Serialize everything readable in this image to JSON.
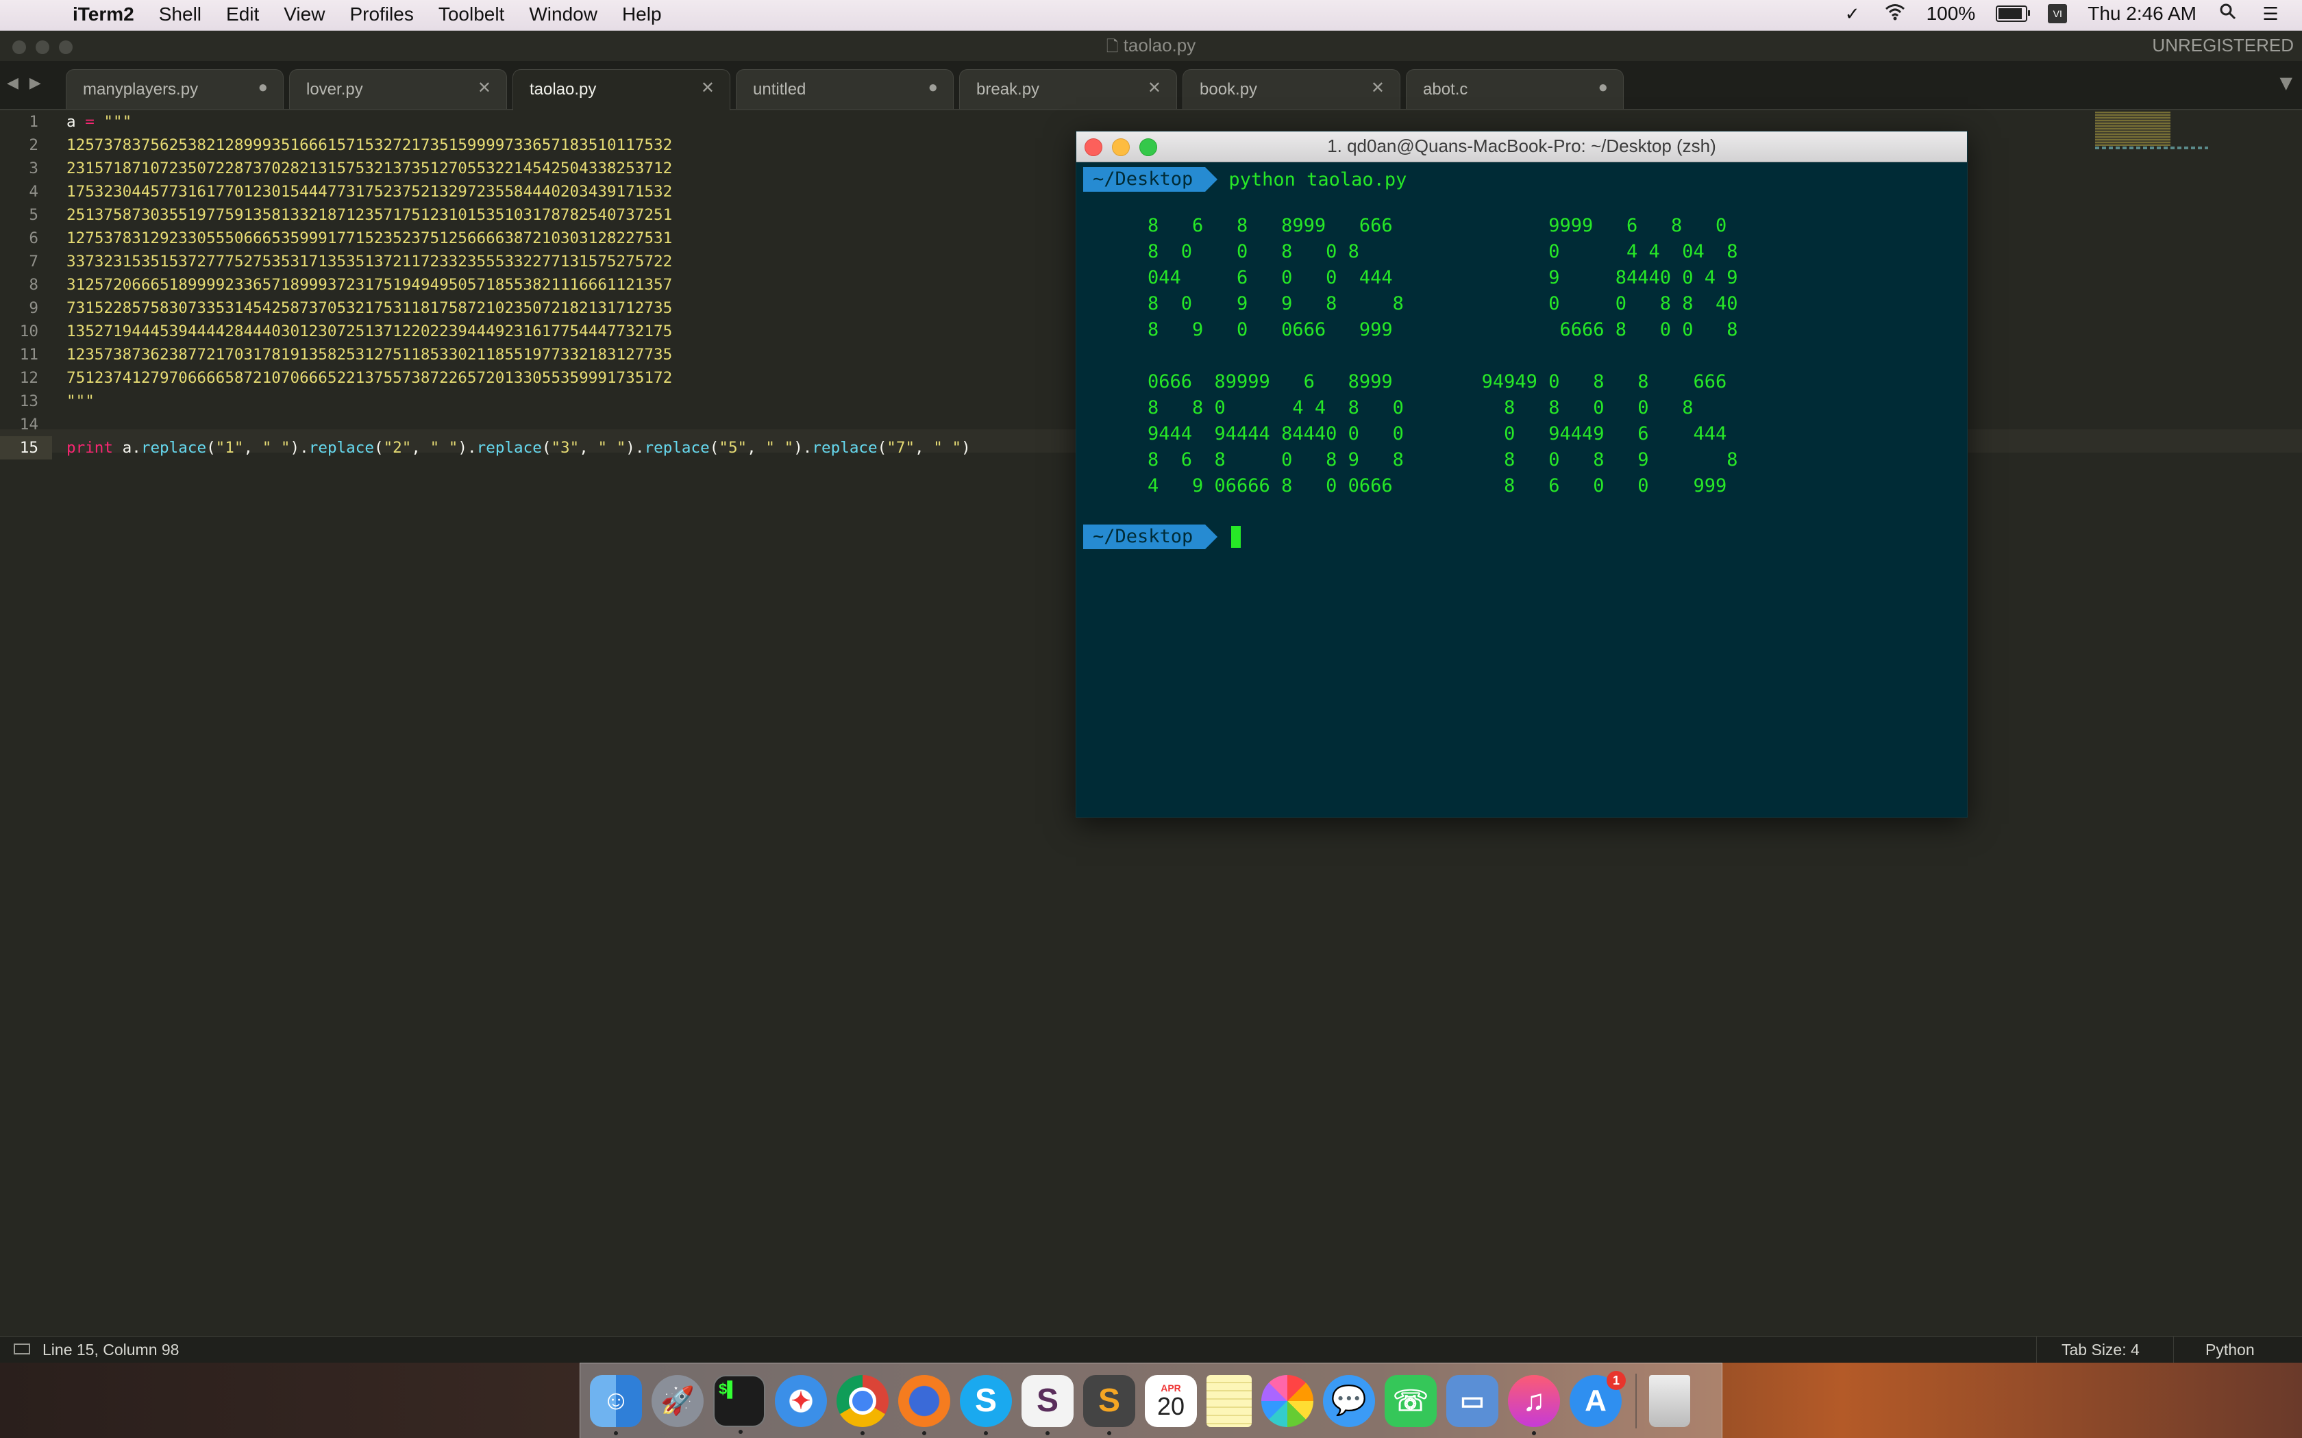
{
  "menubar": {
    "app_name": "iTerm2",
    "menus": [
      "Shell",
      "Edit",
      "View",
      "Profiles",
      "Toolbelt",
      "Window",
      "Help"
    ],
    "battery_percent": "100%",
    "clock": "Thu 2:46 AM"
  },
  "window": {
    "title": "taolao.py",
    "unregistered": "UNREGISTERED"
  },
  "tabs": [
    {
      "label": "manyplayers.py",
      "close": "●",
      "active": false
    },
    {
      "label": "lover.py",
      "close": "✕",
      "active": false
    },
    {
      "label": "taolao.py",
      "close": "✕",
      "active": true
    },
    {
      "label": "untitled",
      "close": "●",
      "active": false
    },
    {
      "label": "break.py",
      "close": "✕",
      "active": false
    },
    {
      "label": "book.py",
      "close": "✕",
      "active": false
    },
    {
      "label": "abot.c",
      "close": "●",
      "active": false
    }
  ],
  "editor": {
    "line_numbers": [
      "1",
      "2",
      "3",
      "4",
      "5",
      "6",
      "7",
      "8",
      "9",
      "10",
      "11",
      "12",
      "13",
      "14",
      "15"
    ],
    "current_line": 15,
    "line1": {
      "var": "a",
      "op": " = ",
      "str": "\"\"\""
    },
    "data_lines": [
      "12573783756253821289993516661571532721735159999733657183510117532",
      "23157187107235072287370282131575321373512705532214542504338253712",
      "17532304457731617701230154447731752375213297235584440203439171532",
      "25137587303551977591358133218712357175123101535103178782540737251",
      "12753783129233055506665359991771523523751256666387210303128227531",
      "33732315351537277752753531713535137211723323555332277131575275722",
      "31257206665189999233657189993723175194949505718553821116661121357",
      "73152285758307335314542587370532175311817587210235072182131712735",
      "13527194445394444284440301230725137122022394449231617754447732175",
      "12357387362387721703178191358253127511853302118551977332183127735",
      "75123741279706666587210706665221375573872265720133055359991735172"
    ],
    "closing": "\"\"\"",
    "print_line": {
      "kw": "print",
      "var": "a",
      "calls": [
        {
          "fn": "replace",
          "a": "\"1\"",
          "b": "\" \""
        },
        {
          "fn": "replace",
          "a": "\"2\"",
          "b": "\" \""
        },
        {
          "fn": "replace",
          "a": "\"3\"",
          "b": "\" \""
        },
        {
          "fn": "replace",
          "a": "\"5\"",
          "b": "\" \""
        },
        {
          "fn": "replace",
          "a": "\"7\"",
          "b": "\" \""
        }
      ]
    }
  },
  "terminal": {
    "title": "1. qd0an@Quans-MacBook-Pro: ~/Desktop (zsh)",
    "prompt_dir": "~/Desktop",
    "command": "python taolao.py",
    "output": "8   6   8   8999   666              9999   6   8   0\n8  0    0   8   0 8                 0      4 4  04  8\n044     6   0   0  444              9     84440 0 4 9\n8  0    9   9   8     8             0     0   8 8  40\n8   9   0   0666   999               6666 8   0 0   8\n\n0666  89999   6   8999        94949 0   8   8    666\n8   8 0      4 4  8   0         8   8   0   0   8\n9444  94444 84440 0   0         0   94449   6    444\n8  6  8     0   8 9   8         8   0   8   9       8\n4   9 06666 8   0 0666          8   6   0   0    999",
    "prompt2_dir": "~/Desktop"
  },
  "statusbar": {
    "position": "Line 15, Column 98",
    "tab_size": "Tab Size: 4",
    "syntax": "Python"
  },
  "dock": {
    "items": [
      "finder-icon",
      "launchpad-icon",
      "terminal-icon",
      "safari-icon",
      "chrome-icon",
      "firefox-icon",
      "skype-icon",
      "slack-icon",
      "sublime-icon",
      "calendar-icon",
      "notes-icon",
      "photos-icon",
      "messages-icon",
      "facetime-icon",
      "keynote-icon",
      "itunes-icon",
      "appstore-icon",
      "trash-icon"
    ],
    "calendar_month": "APR",
    "calendar_day": "20",
    "appstore_badge": "1"
  }
}
